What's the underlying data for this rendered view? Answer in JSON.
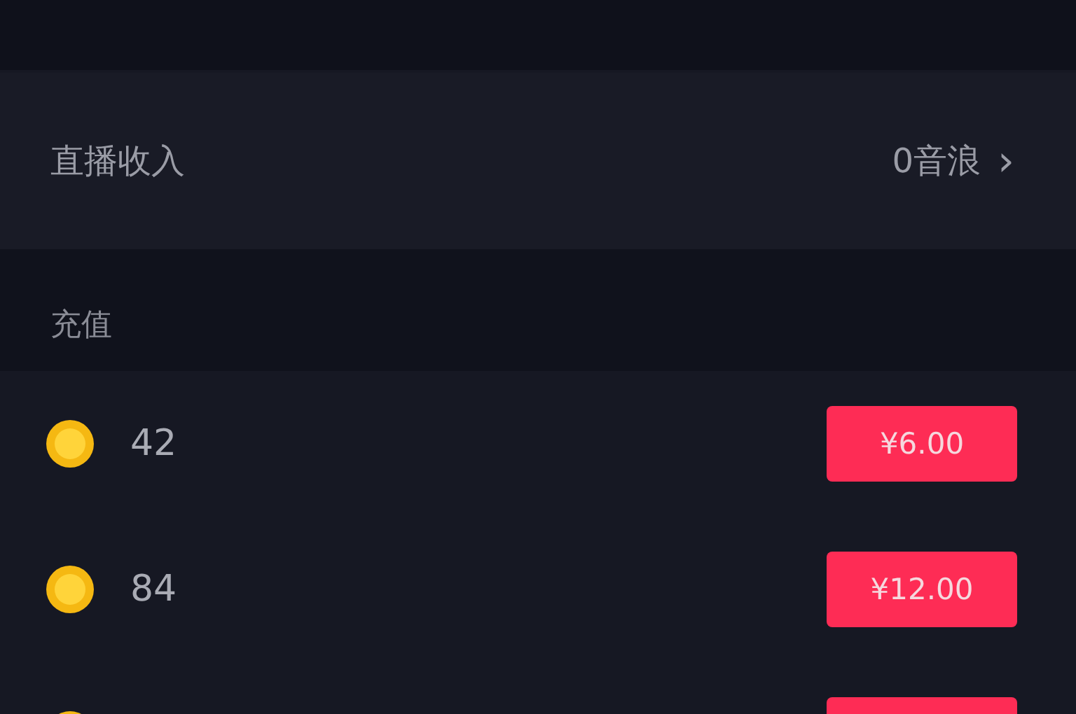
{
  "income": {
    "label": "直播收入",
    "value": "0音浪",
    "chevron": "›"
  },
  "recharge": {
    "title": "充值",
    "items": [
      {
        "coins": "42",
        "price": "¥6.00"
      },
      {
        "coins": "84",
        "price": "¥12.00"
      }
    ]
  }
}
